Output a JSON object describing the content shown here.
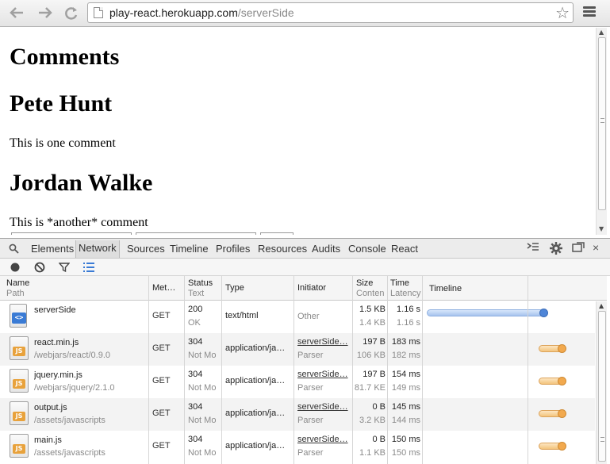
{
  "browser": {
    "url_host": "play-react.herokuapp.com",
    "url_path": "/serverSide",
    "back_icon": "back-arrow-icon",
    "forward_icon": "forward-arrow-icon",
    "reload_icon": "reload-icon",
    "bookmark_icon": "star-icon",
    "menu_icon": "hamburger-menu-icon"
  },
  "page": {
    "heading": "Comments",
    "comments": [
      {
        "author": "Pete Hunt",
        "text": "This is one comment"
      },
      {
        "author": "Jordan Walke",
        "text": "This is *another* comment"
      }
    ]
  },
  "devtools": {
    "tabs": [
      "Elements",
      "Network",
      "Sources",
      "Timeline",
      "Profiles",
      "Resources",
      "Audits",
      "Console",
      "React"
    ],
    "active_tab": "Network",
    "columns": {
      "name": "Name",
      "name_sub": "Path",
      "method": "Met…",
      "status": "Status",
      "status_sub": "Text",
      "type": "Type",
      "initiator": "Initiator",
      "size": "Size",
      "size_sub": "Conten",
      "time": "Time",
      "time_sub": "Latency",
      "timeline": "Timeline"
    },
    "requests": [
      {
        "name": "serverSide",
        "path": "",
        "method": "GET",
        "status": "200",
        "status_text": "OK",
        "type": "text/html",
        "initiator": "",
        "initiator_sub": "Other",
        "size": "1.5 KB",
        "content": "1.4 KB",
        "time": "1.16 s",
        "latency": "1.16 s",
        "icon": "html"
      },
      {
        "name": "react.min.js",
        "path": "/webjars/react/0.9.0",
        "method": "GET",
        "status": "304",
        "status_text": "Not Mo",
        "type": "application/ja…",
        "initiator": "serverSide…",
        "initiator_sub": "Parser",
        "size": "197 B",
        "content": "106 KB",
        "time": "183 ms",
        "latency": "182 ms",
        "icon": "js"
      },
      {
        "name": "jquery.min.js",
        "path": "/webjars/jquery/2.1.0",
        "method": "GET",
        "status": "304",
        "status_text": "Not Mo",
        "type": "application/ja…",
        "initiator": "serverSide…",
        "initiator_sub": "Parser",
        "size": "197 B",
        "content": "81.7 KE",
        "time": "154 ms",
        "latency": "149 ms",
        "icon": "js"
      },
      {
        "name": "output.js",
        "path": "/assets/javascripts",
        "method": "GET",
        "status": "304",
        "status_text": "Not Mo",
        "type": "application/ja…",
        "initiator": "serverSide…",
        "initiator_sub": "Parser",
        "size": "0 B",
        "content": "3.2 KB",
        "time": "145 ms",
        "latency": "144 ms",
        "icon": "js"
      },
      {
        "name": "main.js",
        "path": "/assets/javascripts",
        "method": "GET",
        "status": "304",
        "status_text": "Not Mo",
        "type": "application/ja…",
        "initiator": "serverSide…",
        "initiator_sub": "Parser",
        "size": "0 B",
        "content": "1.1 KB",
        "time": "150 ms",
        "latency": "150 ms",
        "icon": "js"
      }
    ],
    "colors": {
      "timeline_html": "#4f86d8",
      "timeline_js": "#f2a94e"
    }
  }
}
